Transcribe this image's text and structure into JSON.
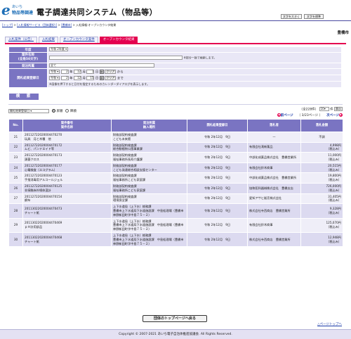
{
  "header": {
    "logo_e": "e",
    "logo_top": "あいち",
    "logo_bottom": "物品等調達",
    "title": "電子調達共同システム（物品等）",
    "font_large": "文字を大きく",
    "font_std": "文字を標準"
  },
  "breadcrumb": [
    {
      "label": "トップ",
      "link": true
    },
    {
      "label": " > ",
      "link": false
    },
    {
      "label": "入札情報サービス（団体選択）",
      "link": true
    },
    {
      "label": " > ",
      "link": false
    },
    {
      "label": "豊橋市",
      "link": true
    },
    {
      "label": " > 入札情報:オープンカウンタ結果",
      "link": false
    }
  ],
  "city": "豊橋市",
  "tabs": [
    {
      "label": "入札案件（公告）",
      "active": false
    },
    {
      "label": "入札結果",
      "active": false
    },
    {
      "label": "オープンカウンタ案件",
      "active": false
    },
    {
      "label": "オープンカウンタ結果",
      "active": true
    }
  ],
  "form": {
    "year_label": "年度",
    "year_value": "令和 2年度",
    "case_name_label": "案件名称",
    "case_name_sub": "(全角50文字)",
    "case_name_note": "※部分一致で検索します。",
    "dept_label": "発注所属",
    "dept_value": "全て",
    "date_label": "開札結果登録日",
    "era": "令和",
    "from": {
      "y": "2",
      "m": "12",
      "d": "1"
    },
    "to": {
      "y": "2",
      "m": "12",
      "d": "15"
    },
    "unit_y": "年",
    "unit_m": "月",
    "unit_d": "日",
    "clear": "クリア",
    "from_suffix": "から",
    "to_suffix": "まで",
    "date_note": "※画像を押下すると日付を指定するためのカレンダーダイアログを表示します。",
    "search_button": "検　索"
  },
  "list": {
    "sort_select": "開札結果登録日",
    "asc": "昇順",
    "desc": "降順",
    "count": "（全228件）",
    "per_page": "10",
    "per_page_unit": "件",
    "page_label": "表示",
    "prev": "前ページ",
    "page_info": "（ 3/23ページ ）",
    "next": "次ページ"
  },
  "columns": [
    "No.",
    "案件番号\n案件名称",
    "発注所属\n納入場所",
    "開札結果登録日",
    "落札者",
    "落札金額"
  ],
  "rows": [
    {
      "no": "21",
      "case_no": "20112722020004470270",
      "case_name": "玩具　月と木種　他",
      "dept": "財務部契約検査課\nこども未来館",
      "date": "令和 2年12月　9日",
      "winner": "—",
      "amount": "不調",
      "note": ""
    },
    {
      "no": "22",
      "case_no": "20112722020004470172",
      "case_name": "ムビ、パンドエイド等",
      "dept": "財務部契約検査課\n総合動植物公園事業課",
      "date": "令和 2年12月　9日",
      "winner": "有限会社滝新薬品",
      "amount": "4,998円",
      "note": "（税込み）"
    },
    {
      "no": "23",
      "case_no": "20112722020004470173",
      "case_name": "頭蓋クロス",
      "dept": "財務部契約検査課\n福祉事務所長寿介護課",
      "date": "令和 2年12月　9日",
      "winner": "中部化成薬品株式会社　豊橋営業所",
      "amount": "11,000円",
      "note": "（税込み）"
    },
    {
      "no": "24",
      "case_no": "20112722020004470177",
      "case_name": "心電検査（エコグラム）",
      "dept": "財務部契約検査課\nこども発達総合相談支援センター",
      "date": "令和 2年12月　9日",
      "winner": "有限会社鈴木商事",
      "amount": "20,515円",
      "note": "（税込み）"
    },
    {
      "no": "25",
      "case_no": "20112722020004470123",
      "case_name": "手指消毒用アルコールジェル",
      "dept": "財務部契約検査課\n福祉事務所こども家庭課",
      "date": "令和 2年12月　9日",
      "winner": "中部化成薬品株式会社　豊橋営業所",
      "amount": "19,800円",
      "note": "（税込み）"
    },
    {
      "no": "26",
      "case_no": "20112722020004470125",
      "case_name": "非接触赤外線体温計",
      "dept": "財務部契約検査課\n福祉事務所こども家庭課",
      "date": "令和 2年12月　9日",
      "winner": "協和医科器械株式会社　豊橋支店",
      "amount": "726,000円",
      "note": "（税込み）"
    },
    {
      "no": "27",
      "case_no": "20112722020004470154",
      "case_name": "鋼布",
      "dept": "財務部契約検査課\n環境保全課",
      "date": "令和 2年12月　9日",
      "winner": "愛知アサヒ販売株式会社",
      "amount": "31,405円",
      "note": "（税込み）"
    },
    {
      "no": "28",
      "case_no": "20113022020004470473",
      "case_name": "チャート紙",
      "dept": "上下水道局（上下水）総務課\n豊橋市上下水道局下水道施設課　中島処理場（豊橋市神野新田町字中島７５－２）",
      "date": "令和 2年12月　9日",
      "winner": "株式会社寺西商店　豊橋営業所",
      "amount": "9,328円",
      "note": "（税込み）"
    },
    {
      "no": "29",
      "case_no": "20113022020004470469",
      "case_name": "ｐＨ計用部品",
      "dept": "上下水道局（上下水）総務課\n豊橋市上下水道局下水道施設課　中島処理場（豊橋市神野新田町字中島７５－２）",
      "date": "令和 2年12月　9日",
      "winner": "有限会社鈴木商事",
      "amount": "125,070円",
      "note": "（税込み）"
    },
    {
      "no": "30",
      "case_no": "20113022020004470468",
      "case_name": "チャート紙",
      "dept": "上下水道局（上下水）総務課\n豊橋市上下水道局下水道施設課　中島処理場（豊橋市神野新田町字中島７５－２）",
      "date": "令和 2年12月　9日",
      "winner": "株式会社寺西商店　豊橋営業所",
      "amount": "12,948円",
      "note": "（税込み）"
    }
  ],
  "bottom": {
    "top_button": "団体のトップページへ戻る",
    "page_top": "△ページトップへ",
    "copyright": "Copyright © 2007-2021 あいち電子自治体推進協議会. All Rights Reserved."
  },
  "colors": {
    "accent": "#e4004f",
    "header_purple": "#7a74c2",
    "row_light": "#efeef8",
    "row_dark": "#dcdaf0",
    "link": "#1a3aa8"
  }
}
